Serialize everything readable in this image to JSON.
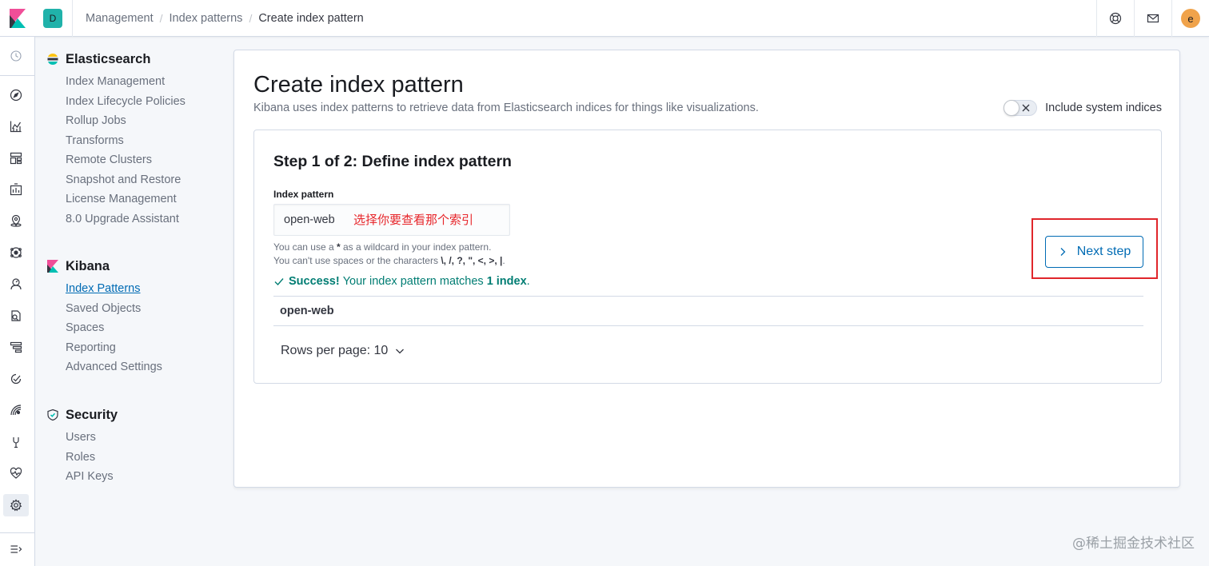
{
  "header": {
    "space_badge": "D",
    "breadcrumbs": [
      "Management",
      "Index patterns",
      "Create index pattern"
    ],
    "avatar_initial": "e"
  },
  "rail": {
    "icons": [
      "recently-viewed-icon",
      "discover-icon",
      "visualize-icon",
      "dashboard-icon",
      "canvas-icon",
      "maps-icon",
      "ml-icon",
      "metrics-icon",
      "logs-icon",
      "apm-icon",
      "uptime-icon",
      "siem-icon",
      "dev-tools-icon",
      "monitoring-icon",
      "management-icon",
      "dock-navigation-icon"
    ]
  },
  "sidenav": {
    "groups": [
      {
        "title": "Elasticsearch",
        "items": [
          "Index Management",
          "Index Lifecycle Policies",
          "Rollup Jobs",
          "Transforms",
          "Remote Clusters",
          "Snapshot and Restore",
          "License Management",
          "8.0 Upgrade Assistant"
        ]
      },
      {
        "title": "Kibana",
        "items": [
          "Index Patterns",
          "Saved Objects",
          "Spaces",
          "Reporting",
          "Advanced Settings"
        ],
        "active_index": 0
      },
      {
        "title": "Security",
        "items": [
          "Users",
          "Roles",
          "API Keys"
        ]
      }
    ]
  },
  "main": {
    "title": "Create index pattern",
    "description": "Kibana uses index patterns to retrieve data from Elasticsearch indices for things like visualizations.",
    "include_system_label": "Include system indices",
    "include_system_on": false,
    "step": {
      "title": "Step 1 of 2: Define index pattern",
      "field_label": "Index pattern",
      "field_value": "open-web",
      "annotation": "选择你要查看那个索引",
      "help_line1_pre": "You can use a",
      "help_star": "*",
      "help_line1_post": "as a wildcard in your index pattern.",
      "help_line2_pre": "You can't use spaces or the characters",
      "help_chars": "\\, /, ?, \", <, >, |",
      "help_line2_post": ".",
      "success_strong": "Success!",
      "success_text": "Your index pattern matches",
      "success_count": "1 index",
      "success_end": ".",
      "matched_index": "open-web",
      "rows_per_page": "Rows per page: 10",
      "next_button": "Next step"
    }
  },
  "watermark": "@稀土掘金技术社区",
  "colors": {
    "accent": "#006bb4",
    "success": "#017d73",
    "highlight_box": "#e0262b",
    "annotation_text": "#e7262b"
  }
}
